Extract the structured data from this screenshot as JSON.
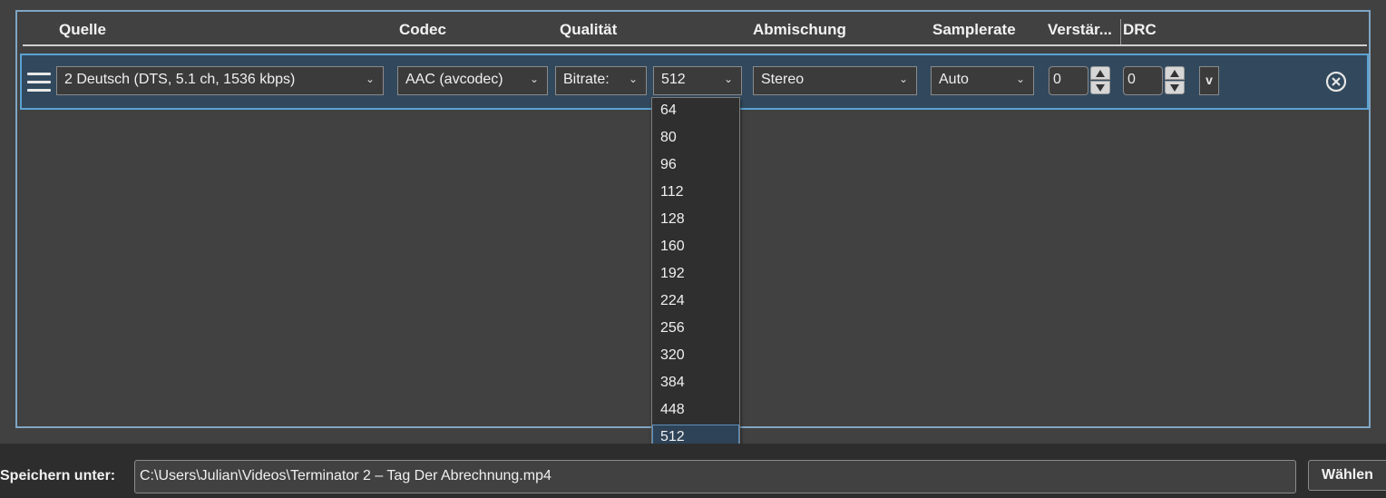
{
  "headers": {
    "source": "Quelle",
    "codec": "Codec",
    "quality": "Qualität",
    "mixdown": "Abmischung",
    "samplerate": "Samplerate",
    "gain": "Verstär...",
    "drc": "DRC"
  },
  "track": {
    "source_value": "2 Deutsch (DTS, 5.1 ch, 1536 kbps)",
    "codec_value": "AAC (avcodec)",
    "quality_mode": "Bitrate:",
    "bitrate_value": "512",
    "mixdown_value": "Stereo",
    "samplerate_value": "Auto",
    "gain_value": "0",
    "drc_value": "0",
    "extra_toggle": "v"
  },
  "bitrate_options": [
    "64",
    "80",
    "96",
    "112",
    "128",
    "160",
    "192",
    "224",
    "256",
    "320",
    "384",
    "448",
    "512"
  ],
  "bitrate_selected": "512",
  "footer": {
    "save_label": "Speichern unter:",
    "path_value": "C:\\Users\\Julian\\Videos\\Terminator 2 – Tag Der Abrechnung.mp4",
    "choose_label": "Wählen"
  },
  "icons": {
    "drag": "drag-handle-icon",
    "dropdown": "chevron-down-icon",
    "spin_up": "triangle-up-icon",
    "spin_down": "triangle-down-icon",
    "remove": "circle-x-icon"
  },
  "colors": {
    "background": "#414141",
    "row_selected": "#32495d",
    "accent_border": "#5aa3d4",
    "panel_border": "#7fa5c4"
  }
}
